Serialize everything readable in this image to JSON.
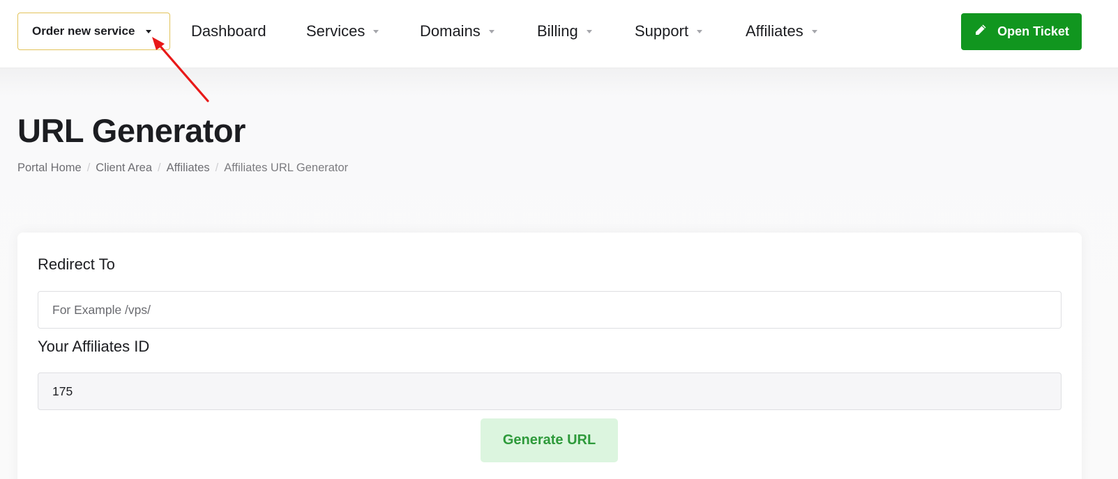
{
  "header": {
    "order_button": {
      "label": "Order new service",
      "icon": "caret-down-icon"
    },
    "nav": [
      {
        "label": "Dashboard",
        "has_dropdown": false
      },
      {
        "label": "Services",
        "has_dropdown": true
      },
      {
        "label": "Domains",
        "has_dropdown": true
      },
      {
        "label": "Billing",
        "has_dropdown": true
      },
      {
        "label": "Support",
        "has_dropdown": true
      },
      {
        "label": "Affiliates",
        "has_dropdown": true
      }
    ],
    "open_ticket": {
      "label": "Open Ticket",
      "icon": "pencil-icon",
      "color": "#11961f"
    }
  },
  "page": {
    "title": "URL Generator",
    "breadcrumb": [
      {
        "label": "Portal Home"
      },
      {
        "label": "Client Area"
      },
      {
        "label": "Affiliates"
      },
      {
        "label": "Affiliates URL Generator",
        "active": true
      }
    ]
  },
  "form": {
    "redirect": {
      "label": "Redirect To",
      "value": "",
      "placeholder": "For Example /vps/"
    },
    "affiliate_id": {
      "label": "Your Affiliates ID",
      "value": "175"
    },
    "generate_button": {
      "label": "Generate URL",
      "bg": "#dcf5df",
      "color": "#2e9a3b"
    }
  },
  "annotation": {
    "type": "red-arrow",
    "points_to": "order-new-service-caret"
  }
}
